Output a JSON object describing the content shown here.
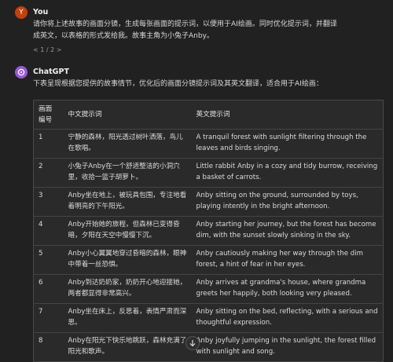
{
  "user": {
    "avatar_letter": "Y",
    "name": "You",
    "message_lines": [
      "请你将上述故事的画面分镜，生成每张画面的提示词，以便用于AI绘画。同时优化提示词，并翻译",
      "成英文，以表格的形式发给我。故事主角为小兔子Anby。"
    ],
    "pager": "< 1 / 2 >"
  },
  "assistant": {
    "avatar_icon": "openai-logo-icon",
    "name": "ChatGPT",
    "intro": "下表呈现根据您提供的故事情节，优化后的画面分镜提示词及其英文翻译，适合用于AI绘画："
  },
  "table": {
    "headers": [
      "画面编号",
      "中文提示词",
      "英文提示词"
    ],
    "rows": [
      [
        "1",
        "宁静的森林，阳光透过树叶洒落，鸟儿在歌唱。",
        "A tranquil forest with sunlight filtering through the leaves and birds singing."
      ],
      [
        "2",
        "小兔子Anby在一个舒适整洁的小洞穴里，收拾一篮子胡萝卜。",
        "Little rabbit Anby in a cozy and tidy burrow, receiving a basket of carrots."
      ],
      [
        "3",
        "Anby坐在地上，被玩具包围，专注地看着明亮的下午阳光。",
        "Anby sitting on the ground, surrounded by toys, playing intently in the bright afternoon."
      ],
      [
        "4",
        "Anby开始她的旅程，但森林已变得昏暗，夕阳在天空中慢慢下沉。",
        "Anby starting her journey, but the forest has become dim, with the sunset slowly sinking in the sky."
      ],
      [
        "5",
        "Anby小心翼翼地穿过昏暗的森林，眼神中带着一丝恐惧。",
        "Anby cautiously making her way through the dim forest, a hint of fear in her eyes."
      ],
      [
        "6",
        "Anby到达奶奶家，奶奶开心地迎接她，两者都显得非常高兴。",
        "Anby arrives at grandma's house, where grandma greets her happily, both looking very pleased."
      ],
      [
        "7",
        "Anby坐在床上，反思着，表情严肃而深思。",
        "Anby sitting on the bed, reflecting, with a serious and thoughtful expression."
      ],
      [
        "8",
        "Anby在阳光下快乐地跳跃，森林充满了阳光和歌声。",
        "Anby joyfully jumping in the sunlight, the forest filled with sunlight and song."
      ]
    ]
  },
  "colors": {
    "user_avatar": "#c2410c",
    "assistant_avatar": "#9b59d6"
  }
}
